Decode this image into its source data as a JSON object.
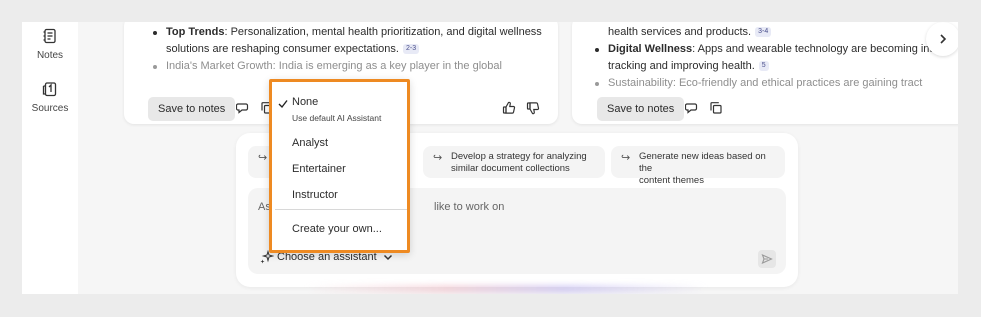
{
  "nav": {
    "items": [
      {
        "label": "Notes",
        "icon": "notes-icon"
      },
      {
        "label": "Sources",
        "icon": "sources-icon"
      }
    ]
  },
  "cards": {
    "left": {
      "bullets": [
        {
          "title": "Top Trends",
          "text": ": Personalization, mental health prioritization, and digital wellness"
        },
        {
          "text": "solutions are reshaping consumer expectations.",
          "cite": "2-3"
        },
        {
          "title": "India's Market Growth",
          "text": ": India is emerging as a key player in the global"
        }
      ],
      "save_label": "Save to notes"
    },
    "right": {
      "bullets": [
        {
          "text": "health services and products.",
          "cite": "3-4"
        },
        {
          "title": "Digital Wellness",
          "text": ": Apps and wearable technology are becoming inte"
        },
        {
          "text": "tracking and improving health.",
          "cite": "5"
        },
        {
          "title": "Sustainability",
          "text": ": Eco-friendly and ethical practices are gaining tract"
        }
      ],
      "save_label": "Save to notes"
    }
  },
  "suggestions": [
    {
      "line1": "Develop a strategy for analyzing",
      "line2": "similar document collections"
    },
    {
      "line1": "Generate new ideas based on the",
      "line2": "content themes"
    }
  ],
  "input": {
    "placeholder_start": "As",
    "placeholder_end": "like to work on"
  },
  "assistant_selector": {
    "label": "Choose an assistant"
  },
  "dropdown": {
    "selected": "None",
    "options": [
      {
        "label": "None",
        "sublabel": "Use default AI Assistant",
        "checked": true
      },
      {
        "label": "Analyst"
      },
      {
        "label": "Entertainer"
      },
      {
        "label": "Instructor"
      }
    ],
    "create_label": "Create your own..."
  },
  "colors": {
    "highlight_border": "#ee8a22",
    "citation_bg": "#e8eaf6"
  }
}
